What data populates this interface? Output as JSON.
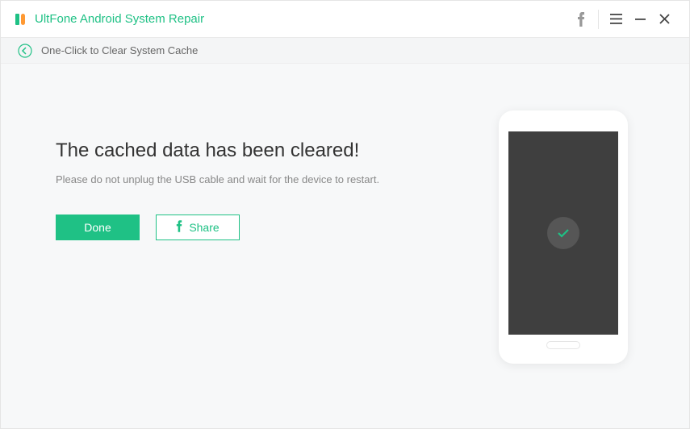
{
  "app": {
    "title": "UltFone Android System Repair"
  },
  "breadcrumb": {
    "text": "One-Click to Clear System Cache"
  },
  "content": {
    "heading": "The cached data has been cleared!",
    "subtext": "Please do not unplug the USB cable and wait for the device to restart.",
    "done_label": "Done",
    "share_label": "Share"
  },
  "colors": {
    "accent": "#1fc185"
  }
}
